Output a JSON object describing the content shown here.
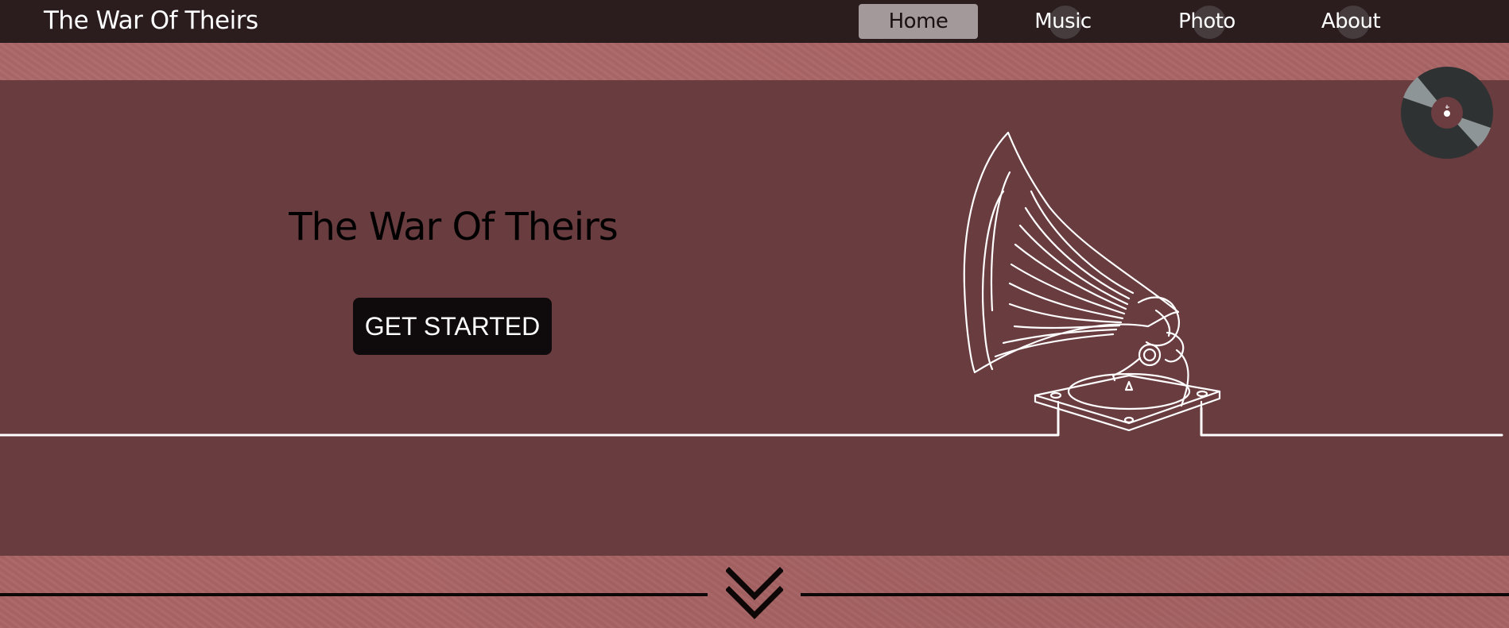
{
  "brand": {
    "name": "The War Of Theirs"
  },
  "nav": {
    "items": [
      {
        "label": "Home",
        "active": true
      },
      {
        "label": "Music",
        "active": false
      },
      {
        "label": "Photo",
        "active": false
      },
      {
        "label": "About",
        "active": false
      }
    ]
  },
  "hero": {
    "title": "The War Of Theirs",
    "cta_label": "GET STARTED",
    "illustration": "gramophone-line-art"
  },
  "player": {
    "icon": "vinyl-record-icon"
  },
  "scroll": {
    "icon": "double-chevron-down-icon"
  },
  "colors": {
    "nav_bg": "#2b1c1e",
    "page_bg": "#a96465",
    "hero_bg": "#693c3f",
    "button_bg": "#0f0a0b",
    "active_nav_bg": "#a3999a",
    "line_art": "#ffffff"
  }
}
